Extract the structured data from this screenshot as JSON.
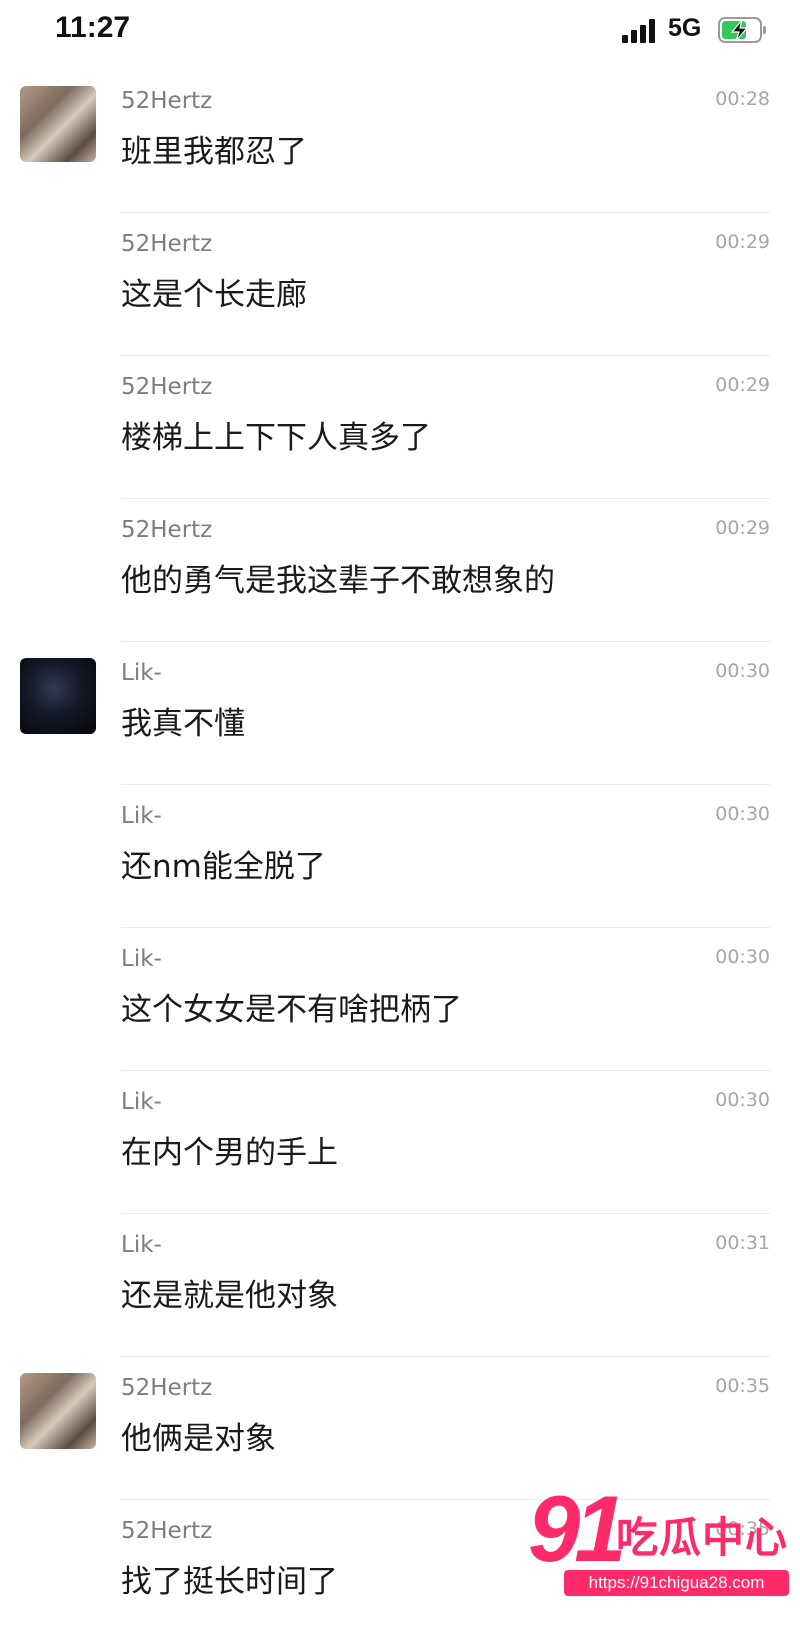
{
  "status_bar": {
    "time": "11:27",
    "network": "5G",
    "icons": [
      "signal-icon",
      "battery-charging-icon"
    ]
  },
  "messages": [
    {
      "sender": "52Hertz",
      "time": "00:28",
      "text": "班里我都忍了",
      "avatar": "avatar-52hertz"
    },
    {
      "sender": "52Hertz",
      "time": "00:29",
      "text": "这是个长走廊",
      "avatar": null
    },
    {
      "sender": "52Hertz",
      "time": "00:29",
      "text": "楼梯上上下下人真多了",
      "avatar": null
    },
    {
      "sender": "52Hertz",
      "time": "00:29",
      "text": "他的勇气是我这辈子不敢想象的",
      "avatar": null
    },
    {
      "sender": "Lik-",
      "time": "00:30",
      "text": "我真不懂",
      "avatar": "avatar-lik"
    },
    {
      "sender": "Lik-",
      "time": "00:30",
      "text": "还nm能全脱了",
      "avatar": null
    },
    {
      "sender": "Lik-",
      "time": "00:30",
      "text": "这个女女是不有啥把柄了",
      "avatar": null
    },
    {
      "sender": "Lik-",
      "time": "00:30",
      "text": "在内个男的手上",
      "avatar": null
    },
    {
      "sender": "Lik-",
      "time": "00:31",
      "text": "还是就是他对象",
      "avatar": null
    },
    {
      "sender": "52Hertz",
      "time": "00:35",
      "text": "他俩是对象",
      "avatar": "avatar-52hertz"
    },
    {
      "sender": "52Hertz",
      "time": "00:35",
      "text": "找了挺长时间了",
      "avatar": null
    }
  ],
  "watermark": {
    "number": "91",
    "name": "吃瓜中心",
    "url": "https://91chigua28.com"
  }
}
